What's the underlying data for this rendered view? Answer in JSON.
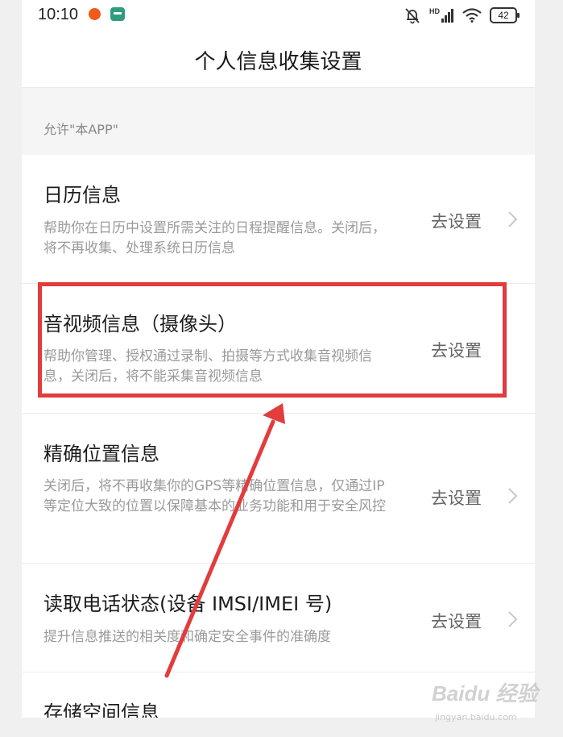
{
  "status_bar": {
    "time": "10:10",
    "network_label": "HD",
    "battery": "42"
  },
  "header": {
    "title": "个人信息收集设置"
  },
  "section": {
    "label": "允许\"本APP\""
  },
  "items": [
    {
      "title": "日历信息",
      "description": "帮助你在日历中设置所需关注的日程提醒信息。关闭后，将不再收集、处理系统日历信息",
      "action": "去设置"
    },
    {
      "title": "音视频信息（摄像头）",
      "description": "帮助你管理、授权通过录制、拍摄等方式收集音视频信息，关闭后，将不能采集音视频信息",
      "action": "去设置"
    },
    {
      "title": "精确位置信息",
      "description": "关闭后，将不再收集你的GPS等精确位置信息，仅通过IP等定位大致的位置以保障基本的业务功能和用于安全风控",
      "action": "去设置"
    },
    {
      "title": "读取电话状态(设备 IMSI/IMEI 号)",
      "description": "提升信息推送的相关度和确定安全事件的准确度",
      "action": "去设置"
    },
    {
      "title": "存储空间信息",
      "description": "",
      "action": ""
    }
  ],
  "watermark": {
    "logo": "Baidu 经验",
    "url": "jingyan.baidu.com"
  },
  "colors": {
    "annotation": "#e23c3c",
    "text_primary": "#1c1c1c",
    "text_secondary": "#9a9a9a"
  }
}
